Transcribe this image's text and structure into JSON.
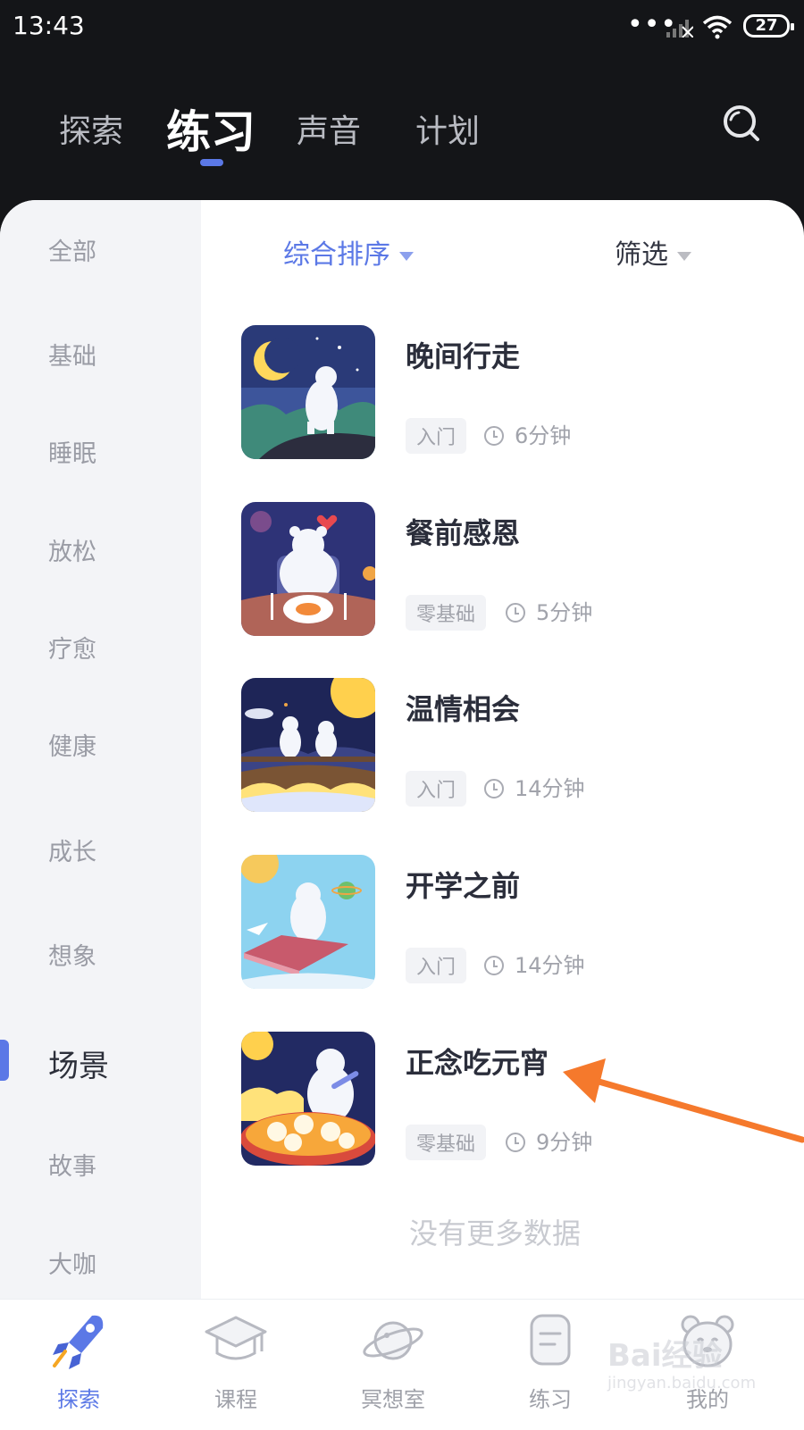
{
  "status_bar": {
    "time": "13:43",
    "battery": "27"
  },
  "top_tabs": [
    {
      "label": "探索"
    },
    {
      "label": "练习"
    },
    {
      "label": "声音"
    },
    {
      "label": "计划"
    }
  ],
  "active_top_tab": "练习",
  "sidebar": {
    "items": [
      {
        "label": "全部"
      },
      {
        "label": "基础"
      },
      {
        "label": "睡眠"
      },
      {
        "label": "放松"
      },
      {
        "label": "疗愈"
      },
      {
        "label": "健康"
      },
      {
        "label": "成长"
      },
      {
        "label": "想象"
      },
      {
        "label": "场景"
      },
      {
        "label": "故事"
      },
      {
        "label": "大咖"
      }
    ],
    "active": "场景"
  },
  "toolbar": {
    "sort_label": "综合排序",
    "filter_label": "筛选"
  },
  "practices": [
    {
      "title": "晚间行走",
      "level": "入门",
      "duration": "6分钟"
    },
    {
      "title": "餐前感恩",
      "level": "零基础",
      "duration": "5分钟"
    },
    {
      "title": "温情相会",
      "level": "入门",
      "duration": "14分钟"
    },
    {
      "title": "开学之前",
      "level": "入门",
      "duration": "14分钟"
    },
    {
      "title": "正念吃元宵",
      "level": "零基础",
      "duration": "9分钟"
    }
  ],
  "list_end_text": "没有更多数据",
  "bottom_nav": {
    "items": [
      {
        "label": "探索",
        "icon": "rocket-icon"
      },
      {
        "label": "课程",
        "icon": "graduation-cap-icon"
      },
      {
        "label": "冥想室",
        "icon": "planet-icon"
      },
      {
        "label": "练习",
        "icon": "document-icon"
      },
      {
        "label": "我的",
        "icon": "bear-face-icon"
      }
    ],
    "active": "探索"
  },
  "watermark": {
    "line1": "Bai经验",
    "line2": "jingyan.baidu.com"
  },
  "colors": {
    "accent": "#5B78E6",
    "arrow": "#F5792C",
    "dark_bg": "#141518"
  }
}
